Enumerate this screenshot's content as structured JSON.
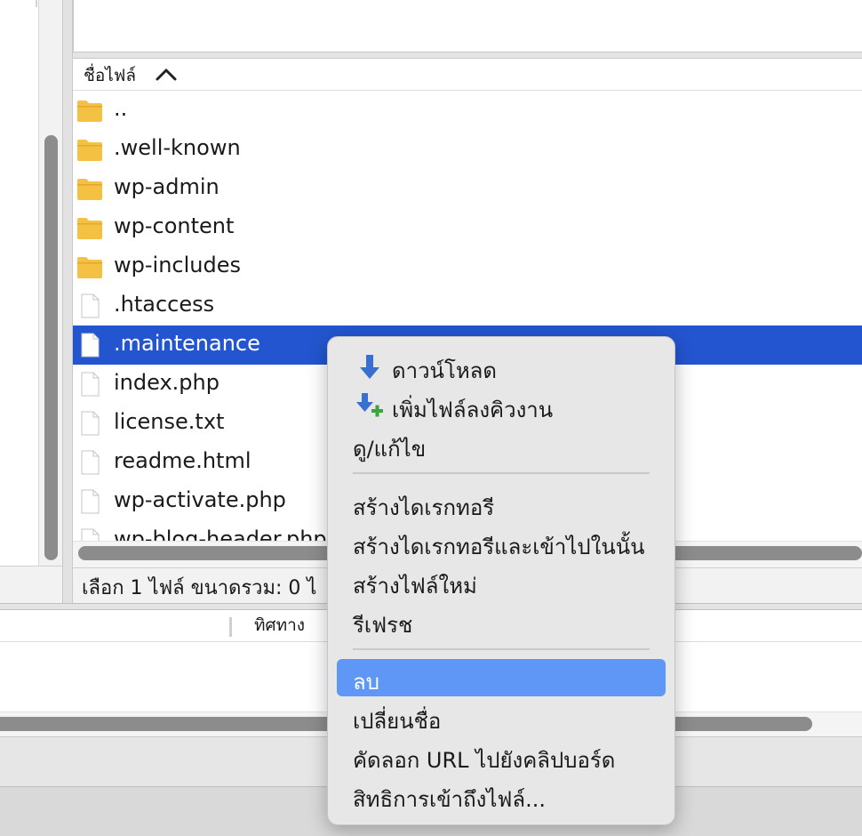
{
  "remote_files": {
    "column_header": "ชื่อไฟล์",
    "rows": [
      {
        "name": "..",
        "type": "folder"
      },
      {
        "name": ".well-known",
        "type": "folder"
      },
      {
        "name": "wp-admin",
        "type": "folder"
      },
      {
        "name": "wp-content",
        "type": "folder"
      },
      {
        "name": "wp-includes",
        "type": "folder"
      },
      {
        "name": ".htaccess",
        "type": "file"
      },
      {
        "name": ".maintenance",
        "type": "file",
        "selected": true
      },
      {
        "name": "index.php",
        "type": "file"
      },
      {
        "name": "license.txt",
        "type": "file"
      },
      {
        "name": "readme.html",
        "type": "file"
      },
      {
        "name": "wp-activate.php",
        "type": "file"
      },
      {
        "name": "wp-blog-header.php",
        "type": "file"
      }
    ],
    "status": "เลือก 1 ไฟล์ ขนาดรวม: 0 ไ"
  },
  "queue": {
    "direction_label": "ทิศทาง"
  },
  "context_menu": {
    "items": [
      {
        "label": "ดาวน์โหลด",
        "icon": "download-arrow-icon"
      },
      {
        "label": "เพิ่มไฟล์ลงคิวงาน",
        "icon": "add-to-queue-icon"
      },
      {
        "label": "ดู/แก้ไข"
      },
      {
        "label": "สร้างไดเรกทอรี"
      },
      {
        "label": "สร้างไดเรกทอรีและเข้าไปในนั้น"
      },
      {
        "label": "สร้างไฟล์ใหม่"
      },
      {
        "label": "รีเฟรช"
      },
      {
        "label": "ลบ",
        "highlighted": true
      },
      {
        "label": "เปลี่ยนชื่อ"
      },
      {
        "label": "คัดลอก URL ไปยังคลิปบอร์ด"
      },
      {
        "label": "สิทธิการเข้าถึงไฟล์..."
      }
    ]
  },
  "colors": {
    "selection": "#2355d0",
    "menu_highlight": "#5e97f6",
    "folder": "#f5c143",
    "scroll_thumb": "#8c8c8c"
  }
}
